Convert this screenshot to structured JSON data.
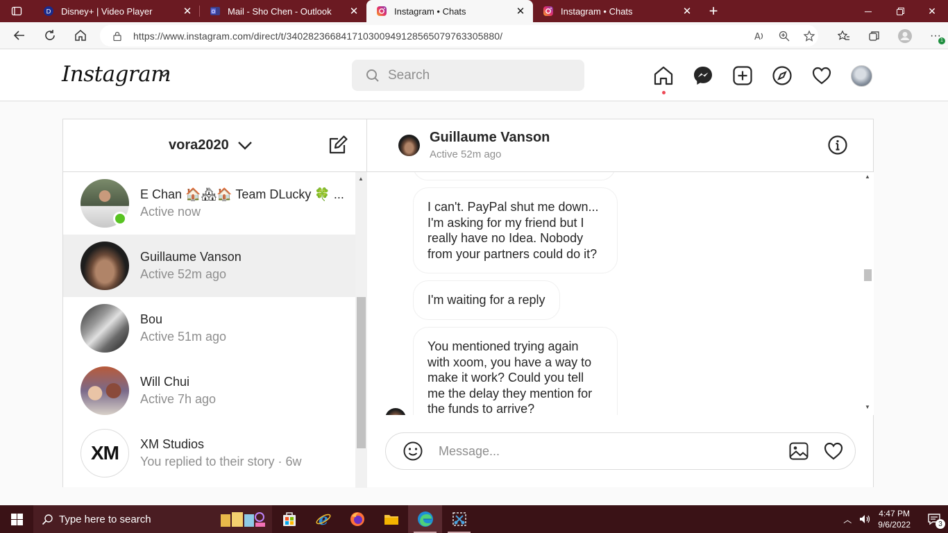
{
  "browser": {
    "tabs": [
      {
        "title": "Disney+ | Video Player",
        "active": false
      },
      {
        "title": "Mail - Sho Chen - Outlook",
        "active": false
      },
      {
        "title": "Instagram • Chats",
        "active": true
      },
      {
        "title": "Instagram • Chats",
        "active": false
      }
    ],
    "url": "https://www.instagram.com/direct/t/340282366841710300949128565079763305880/"
  },
  "header": {
    "logo": "Instagram",
    "search_placeholder": "Search"
  },
  "inbox": {
    "account": "vora2020",
    "threads": [
      {
        "name": "E Chan 🏠🏘🏠 Team DLucky 🍀 ...",
        "status": "Active now",
        "online": true
      },
      {
        "name": "Guillaume Vanson",
        "status": "Active 52m ago",
        "selected": true
      },
      {
        "name": "Bou",
        "status": "Active 51m ago"
      },
      {
        "name": "Will Chui",
        "status": "Active 7h ago"
      },
      {
        "name": "XM Studios",
        "status": "You replied to their story · 6w",
        "avatar_text": "XM"
      }
    ]
  },
  "chat": {
    "name": "Guillaume Vanson",
    "active": "Active 52m ago",
    "messages": [
      "I can't. PayPal shut me down... I'm asking for my friend but I really have no Idea. Nobody from your partners could do it?",
      "I'm waiting for a reply",
      "You mentioned trying again with xoom, you have a way to make it work? Could you tell me the delay they mention for the funds to arrive?"
    ],
    "message_placeholder": "Message..."
  },
  "taskbar": {
    "search_placeholder": "Type here to search",
    "time": "4:47 PM",
    "date": "9/6/2022",
    "notifications": "3"
  },
  "colors": {
    "tabbar": "#6b1a22",
    "taskbar": "#3a1216",
    "online": "#58c322",
    "notification_dot": "#ed4956"
  }
}
